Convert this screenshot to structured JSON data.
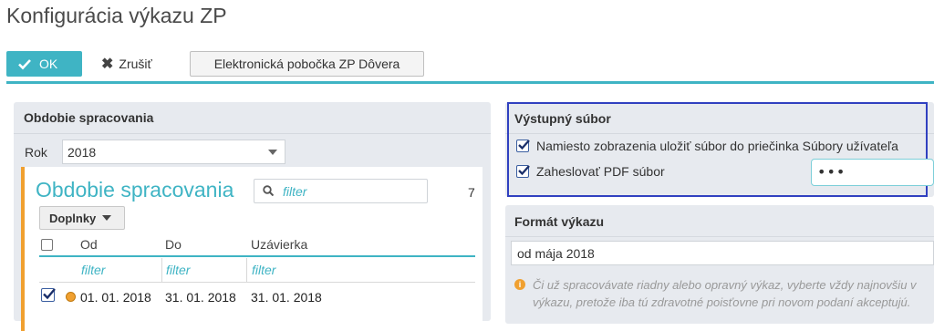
{
  "page": {
    "title": "Konfigurácia výkazu ZP"
  },
  "toolbar": {
    "ok_label": "OK",
    "cancel_label": "Zrušiť",
    "branch_label": "Elektronická pobočka ZP Dôvera"
  },
  "period_panel": {
    "title": "Obdobie spracovania",
    "year_label": "Rok",
    "year_value": "2018",
    "table": {
      "title": "Obdobie spracovania",
      "filter_placeholder": "filter",
      "count": "7",
      "extras_label": "Doplnky",
      "columns": [
        "Od",
        "Do",
        "Uzávierka"
      ],
      "column_filters": [
        "filter",
        "filter",
        "filter"
      ],
      "rows": [
        {
          "od": "01. 01. 2018",
          "do": "31. 01. 2018",
          "uzavierka": "31. 01. 2018",
          "checked": true,
          "status_color": "#f0a030"
        }
      ]
    }
  },
  "output_panel": {
    "title": "Výstupný súbor",
    "options": [
      {
        "label": "Namiesto zobrazenia uložiť súbor do priečinka Súbory užívateľa",
        "checked": true
      },
      {
        "label": "Zaheslovať PDF súbor",
        "checked": true
      }
    ],
    "password_value": "•••"
  },
  "format_panel": {
    "title": "Formát výkazu",
    "selected_value": "od mája 2018",
    "info_lines": [
      "Či už spracovávate riadny alebo opravný výkaz, vyberte vždy najnovšiu v",
      "výkazu, pretože iba tú zdravotné poisťovne pri novom podaní akceptujú."
    ]
  },
  "colors": {
    "accent": "#3fb4c4",
    "warning": "#f0a030",
    "focus": "#3040c0"
  }
}
